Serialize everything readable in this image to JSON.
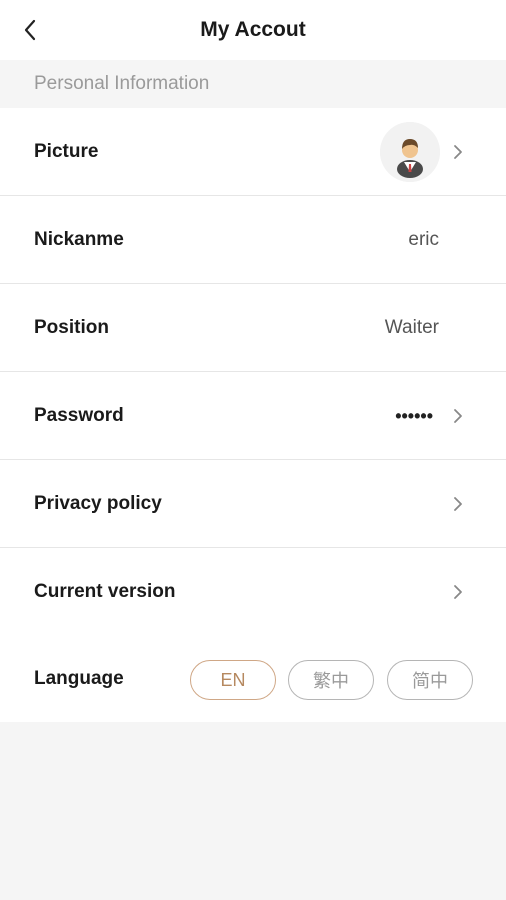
{
  "header": {
    "title": "My Accout"
  },
  "section": {
    "personal_info": "Personal Information"
  },
  "rows": {
    "picture": {
      "label": "Picture"
    },
    "nickname": {
      "label": "Nickanme",
      "value": "eric"
    },
    "position": {
      "label": "Position",
      "value": "Waiter"
    },
    "password": {
      "label": "Password",
      "value": "••••••"
    },
    "privacy": {
      "label": "Privacy policy"
    },
    "version": {
      "label": "Current version"
    },
    "language": {
      "label": "Language",
      "options": [
        "EN",
        "繁中",
        "简中"
      ],
      "selected": "EN"
    }
  },
  "colors": {
    "accent": "#b68960",
    "background": "#f5f5f5",
    "divider": "#e6e6e6"
  },
  "icons": [
    "back-arrow-icon",
    "chevron-right-icon",
    "user-avatar-icon"
  ]
}
